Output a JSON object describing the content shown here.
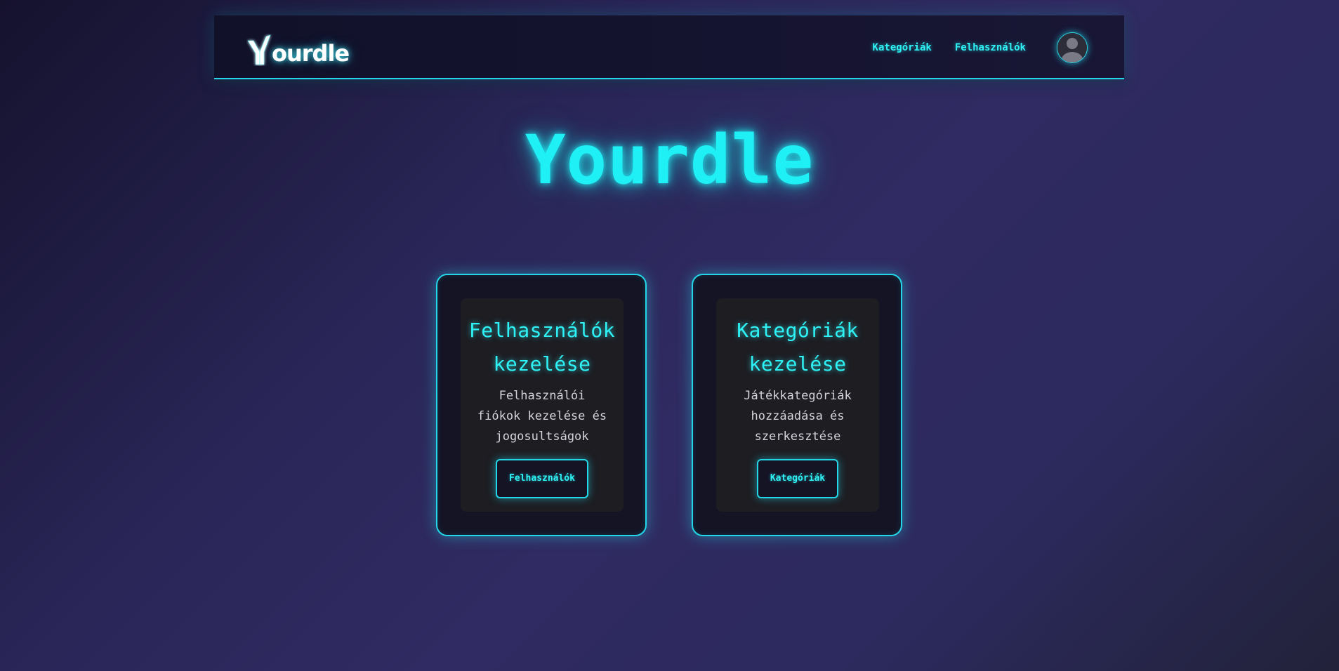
{
  "navbar": {
    "logo_text": "ourdle",
    "links": [
      {
        "label": "Kategóriák"
      },
      {
        "label": "Felhasználók"
      }
    ]
  },
  "hero": {
    "title": "Yourdle"
  },
  "cards": [
    {
      "title": "Felhasználók\nkezelése",
      "description": "Felhasználói\nfiókok kezelése és\njogosultságok",
      "button_label": "Felhasználók"
    },
    {
      "title": "Kategóriák\nkezelése",
      "description": "Játékkategóriák\nhozzáadása és\nszerkesztése",
      "button_label": "Kategóriák"
    }
  ],
  "colors": {
    "accent": "#23d6e8",
    "glow": "#2ef2f5",
    "background": "#2a2658",
    "card_bg": "#141425"
  },
  "icons": {
    "logo": "yourdle-logo-icon",
    "avatar": "user-avatar-icon"
  }
}
